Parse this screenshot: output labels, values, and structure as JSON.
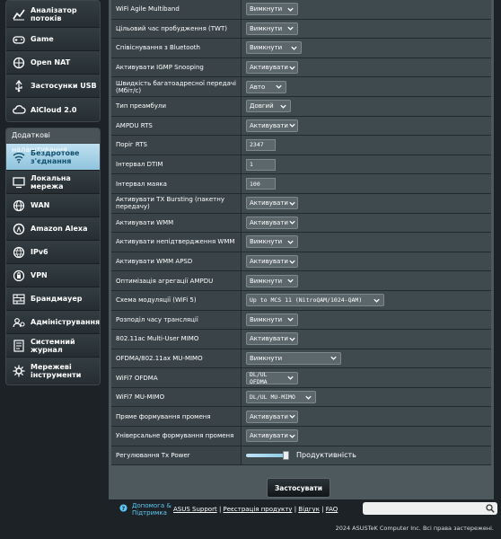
{
  "sidebar": {
    "top_items": [
      {
        "label": "Аналізатор потоків",
        "icon": "traffic-analyzer-icon"
      },
      {
        "label": "Game",
        "icon": "game-icon"
      },
      {
        "label": "Open NAT",
        "icon": "open-nat-icon"
      },
      {
        "label": "Застосунки USB",
        "icon": "usb-icon"
      },
      {
        "label": "AiCloud 2.0",
        "icon": "cloud-icon"
      }
    ],
    "advanced_header": "Додаткові налаштування",
    "advanced_items": [
      {
        "label": "Бездротове з'єднання",
        "icon": "wireless-icon",
        "active": true
      },
      {
        "label": "Локальна мережа",
        "icon": "lan-icon"
      },
      {
        "label": "WAN",
        "icon": "wan-icon"
      },
      {
        "label": "Amazon Alexa",
        "icon": "alexa-icon"
      },
      {
        "label": "IPv6",
        "icon": "ipv6-icon"
      },
      {
        "label": "VPN",
        "icon": "vpn-icon"
      },
      {
        "label": "Брандмауер",
        "icon": "firewall-icon"
      },
      {
        "label": "Адміністрування",
        "icon": "admin-icon"
      },
      {
        "label": "Системний журнал",
        "icon": "syslog-icon"
      },
      {
        "label": "Мережеві інструменти",
        "icon": "network-tools-icon"
      }
    ]
  },
  "settings": [
    {
      "label": "WiFi Agile Multiband",
      "type": "select",
      "value": "Вимкнути"
    },
    {
      "label": "Цільовий час пробудження (TWT)",
      "type": "select",
      "value": "Вимкнути"
    },
    {
      "label": "Співіснування з Bluetooth",
      "type": "select",
      "value": "Вимкнути"
    },
    {
      "label": "Активувати IGMP Snooping",
      "type": "select",
      "value": "Активувати"
    },
    {
      "label": "Швидкість багатоадресної передачі (Мбіт/с)",
      "type": "select",
      "value": "Авто"
    },
    {
      "label": "Тип преамбули",
      "type": "select",
      "value": "Довгий"
    },
    {
      "label": "AMPDU RTS",
      "type": "select",
      "value": "Активувати"
    },
    {
      "label": "Поріг RTS",
      "type": "input",
      "value": "2347"
    },
    {
      "label": "Інтервал DTIM",
      "type": "input",
      "value": "1"
    },
    {
      "label": "Інтервал маяка",
      "type": "input",
      "value": "100"
    },
    {
      "label": "Активувати TX Bursting (пакетну передачу)",
      "type": "select",
      "value": "Активувати"
    },
    {
      "label": "Активувати WMM",
      "type": "select",
      "value": "Активувати"
    },
    {
      "label": "Активувати непідтвердження WMM",
      "type": "select",
      "value": "Вимкнути"
    },
    {
      "label": "Активувати WMM APSD",
      "type": "select",
      "value": "Активувати"
    },
    {
      "label": "Оптимізація агрегації AMPDU",
      "type": "select",
      "value": "Вимкнути"
    },
    {
      "label": "Схема модуляції (WiFi 5)",
      "type": "select",
      "value": "Up to MCS 11 (NitroQAM/1024-QAM)",
      "mono": true
    },
    {
      "label": "Розподіл часу трансляції",
      "type": "select",
      "value": "Вимкнути"
    },
    {
      "label": "802.11ac Multi-User MIMO",
      "type": "select",
      "value": "Активувати"
    },
    {
      "label": "OFDMA/802.11ax MU-MIMO",
      "type": "select",
      "value": "Вимкнути"
    },
    {
      "label": "WiFi7 OFDMA",
      "type": "select",
      "value": "DL/UL OFDMA",
      "mono": true
    },
    {
      "label": "WiFi7 MU-MIMO",
      "type": "select",
      "value": "DL/UL MU-MIMO",
      "mono": true
    },
    {
      "label": "Пряме формування променя",
      "type": "select",
      "value": "Активувати"
    },
    {
      "label": "Універсальне формування променя",
      "type": "select",
      "value": "Активувати"
    },
    {
      "label": "Регулювання Tx Power",
      "type": "slider",
      "value": "Продуктивність",
      "level": 1.0
    }
  ],
  "apply_label": "Застосувати",
  "footer": {
    "help": "Допомога & Підтримка",
    "links": [
      "ASUS Support",
      "Реєстрація продукту",
      "Відгук",
      "FAQ"
    ],
    "copyright": "2024 ASUSTeK Computer Inc. Всі права застережені."
  },
  "colors": {
    "accent": "#5fc8f6",
    "panel": "#4d595d",
    "active_menu": "#a9d5ea"
  }
}
